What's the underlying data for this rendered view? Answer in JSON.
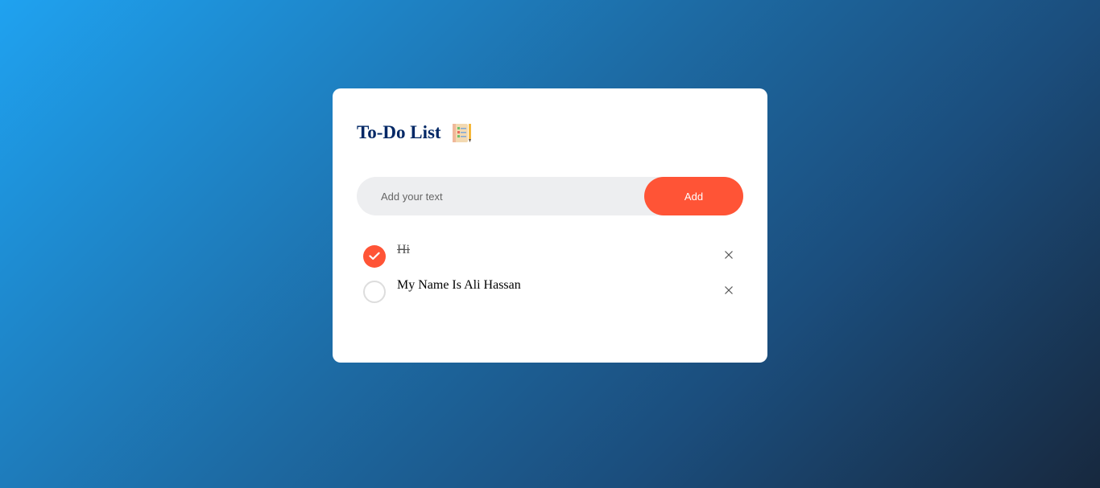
{
  "app": {
    "title": "To-Do List",
    "title_icon": "notepad-icon"
  },
  "input": {
    "placeholder": "Add your text",
    "value": ""
  },
  "add_button": {
    "label": "Add"
  },
  "tasks": [
    {
      "text": "Hi",
      "checked": true
    },
    {
      "text": "My Name Is Ali Hassan",
      "checked": false
    }
  ],
  "icons": {
    "check": "check-icon",
    "delete": "close-icon"
  },
  "colors": {
    "accent": "#ff5436",
    "title": "#002765",
    "input_bg": "#edeef0",
    "card_bg": "#ffffff"
  }
}
